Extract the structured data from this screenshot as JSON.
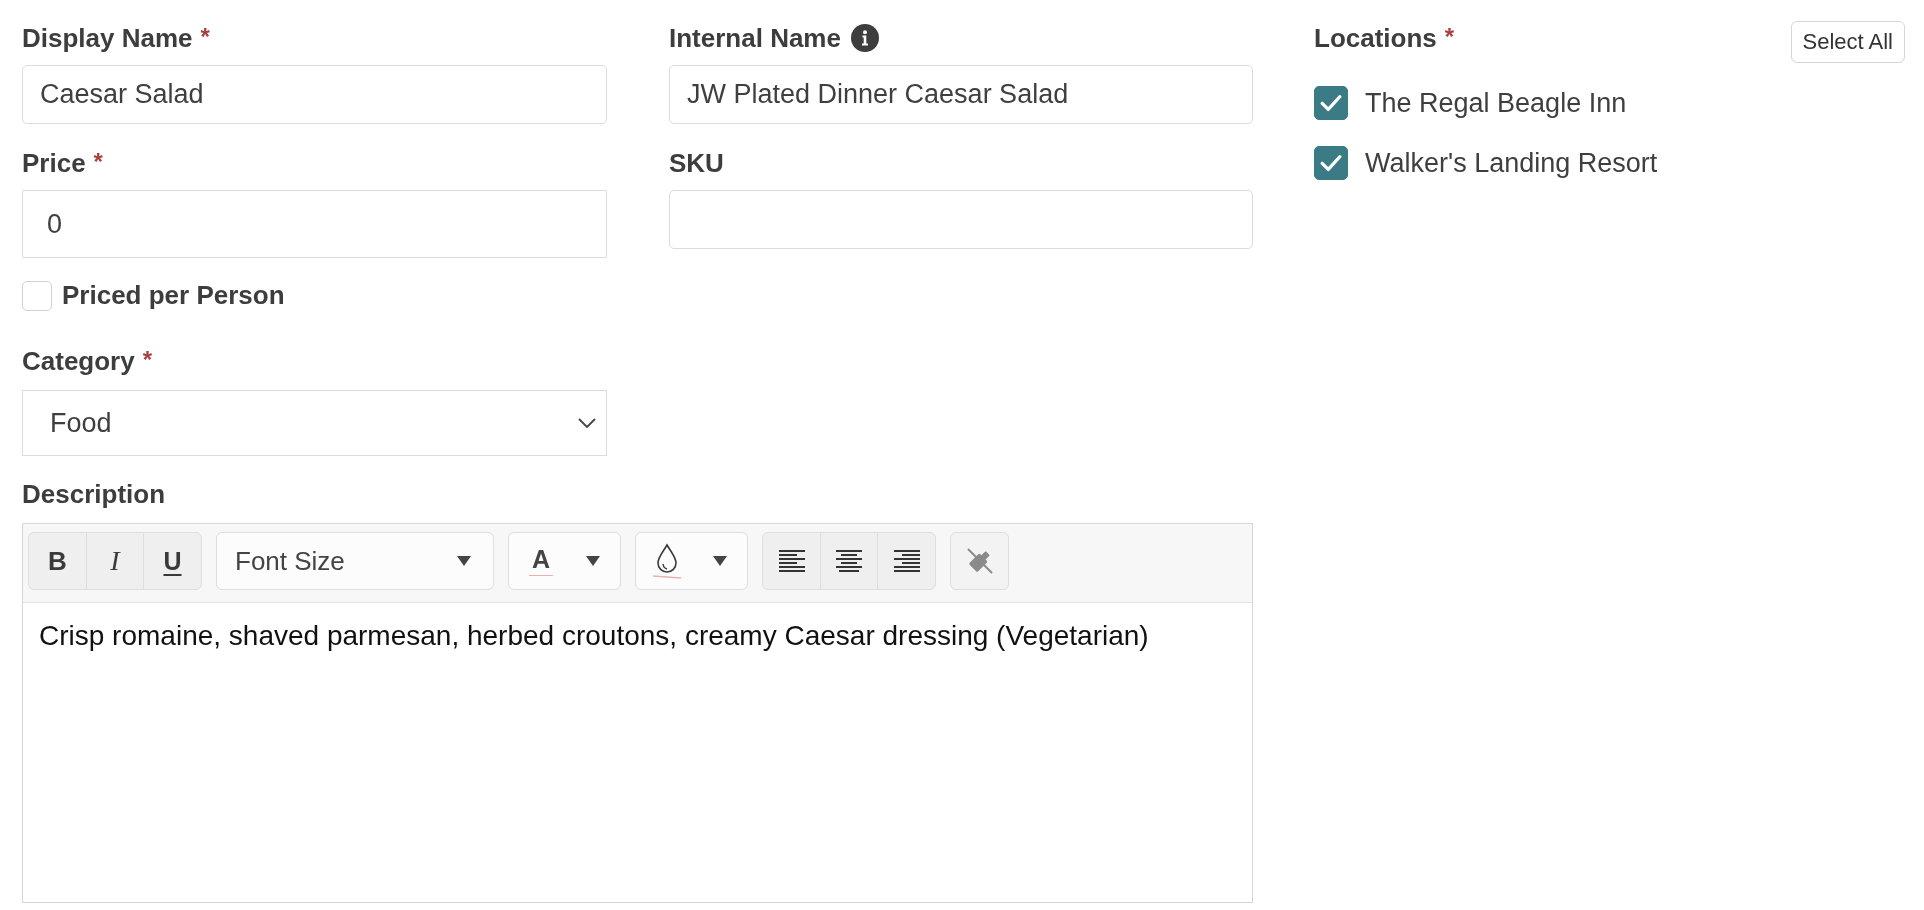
{
  "display_name": {
    "label": "Display Name",
    "required_mark": "*",
    "value": "Caesar Salad"
  },
  "internal_name": {
    "label": "Internal Name",
    "value": "JW Plated Dinner Caesar Salad"
  },
  "price": {
    "label": "Price",
    "required_mark": "*",
    "value": "0"
  },
  "sku": {
    "label": "SKU"
  },
  "priced_per_person": {
    "label": "Priced per Person",
    "checked": false
  },
  "category": {
    "label": "Category",
    "required_mark": "*",
    "value": "Food"
  },
  "description": {
    "label": "Description",
    "toolbar": {
      "style_buttons": [
        {
          "kind": "bold",
          "label": "B"
        },
        {
          "kind": "italic",
          "label": "I"
        },
        {
          "kind": "underline",
          "label": "U"
        }
      ],
      "font_size": "Font Size",
      "font_color": "A",
      "align_buttons": [
        {
          "kind": "left"
        },
        {
          "kind": "center"
        },
        {
          "kind": "right"
        }
      ]
    },
    "text": "Crisp romaine, shaved parmesan, herbed croutons, creamy Caesar dressing (Vegetarian)"
  },
  "locations": {
    "label": "Locations",
    "required_mark": "*",
    "select_all": "Select All",
    "items": [
      {
        "name": "The Regal Beagle Inn",
        "checked": true
      },
      {
        "name": "Walker's Landing Resort",
        "checked": true
      }
    ]
  }
}
